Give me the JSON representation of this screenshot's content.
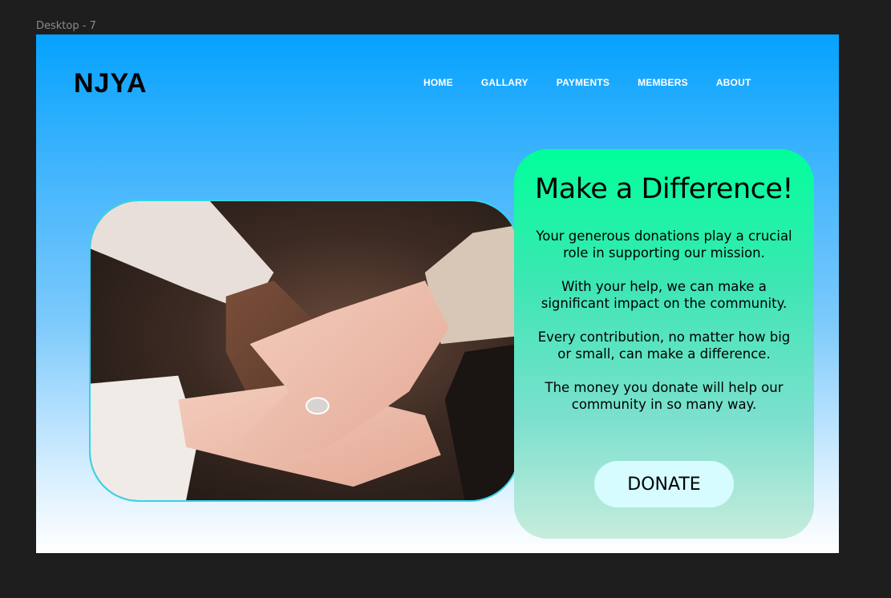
{
  "frame": {
    "label": "Desktop - 7"
  },
  "header": {
    "logo": "NJYA",
    "nav": [
      "HOME",
      "GALLARY",
      "PAYMENTS",
      "MEMBERS",
      "ABOUT"
    ]
  },
  "hero": {
    "image_alt": "hands stacked together"
  },
  "card": {
    "title": "Make a Difference!",
    "paragraphs": [
      "Your generous donations play a crucial role in supporting our mission.",
      "With your help, we can make a significant impact on the community.",
      "Every contribution, no matter how big or small, can make a difference.",
      "The money you donate will help our community in so many way."
    ],
    "button_label": "DONATE"
  },
  "colors": {
    "sky_top": "#05a2fe",
    "card_top": "#00ff9a",
    "button_bg": "#d6fcff",
    "photo_border": "#34d4e8"
  }
}
